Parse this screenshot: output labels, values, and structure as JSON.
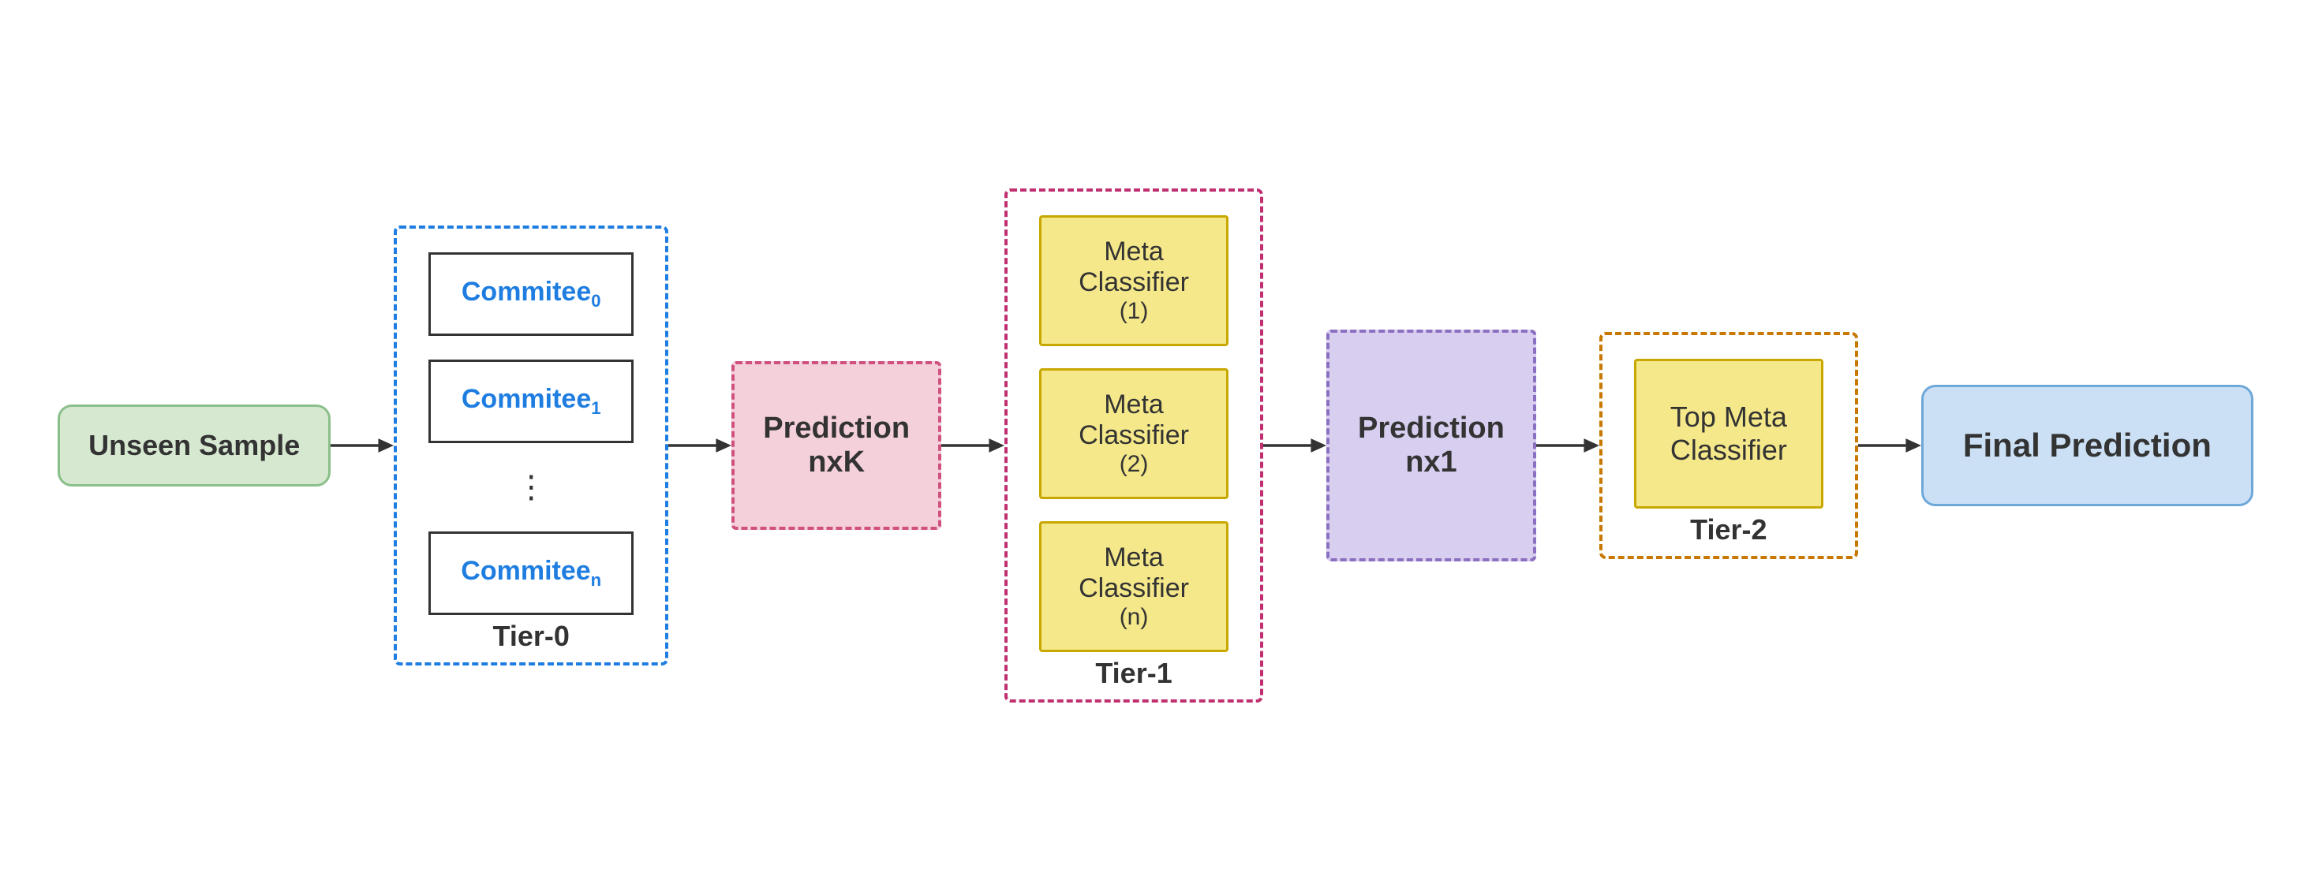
{
  "unseen_sample": {
    "label": "Unseen Sample"
  },
  "tier0": {
    "label": "Tier-0",
    "commitees": [
      {
        "label": "Commitee",
        "subscript": "0"
      },
      {
        "label": "Commitee",
        "subscript": "1"
      },
      {
        "label": "Commitee",
        "subscript": "n"
      }
    ]
  },
  "prediction_nxk": {
    "line1": "Prediction",
    "line2": "nxK"
  },
  "tier1": {
    "label": "Tier-1",
    "meta_classifiers": [
      {
        "label": "Meta\nClassifier",
        "sub": "(1)"
      },
      {
        "label": "Meta\nClassifier",
        "sub": "(2)"
      },
      {
        "label": "Meta\nClassifier",
        "sub": "(n)"
      }
    ]
  },
  "prediction_nx1": {
    "line1": "Prediction",
    "line2": "nx1"
  },
  "tier2": {
    "label": "Tier-2",
    "top_meta": {
      "line1": "Top Meta",
      "line2": "Classifier"
    }
  },
  "final_prediction": {
    "label": "Final Prediction"
  },
  "arrows": {
    "color": "#333333",
    "width": 80
  }
}
